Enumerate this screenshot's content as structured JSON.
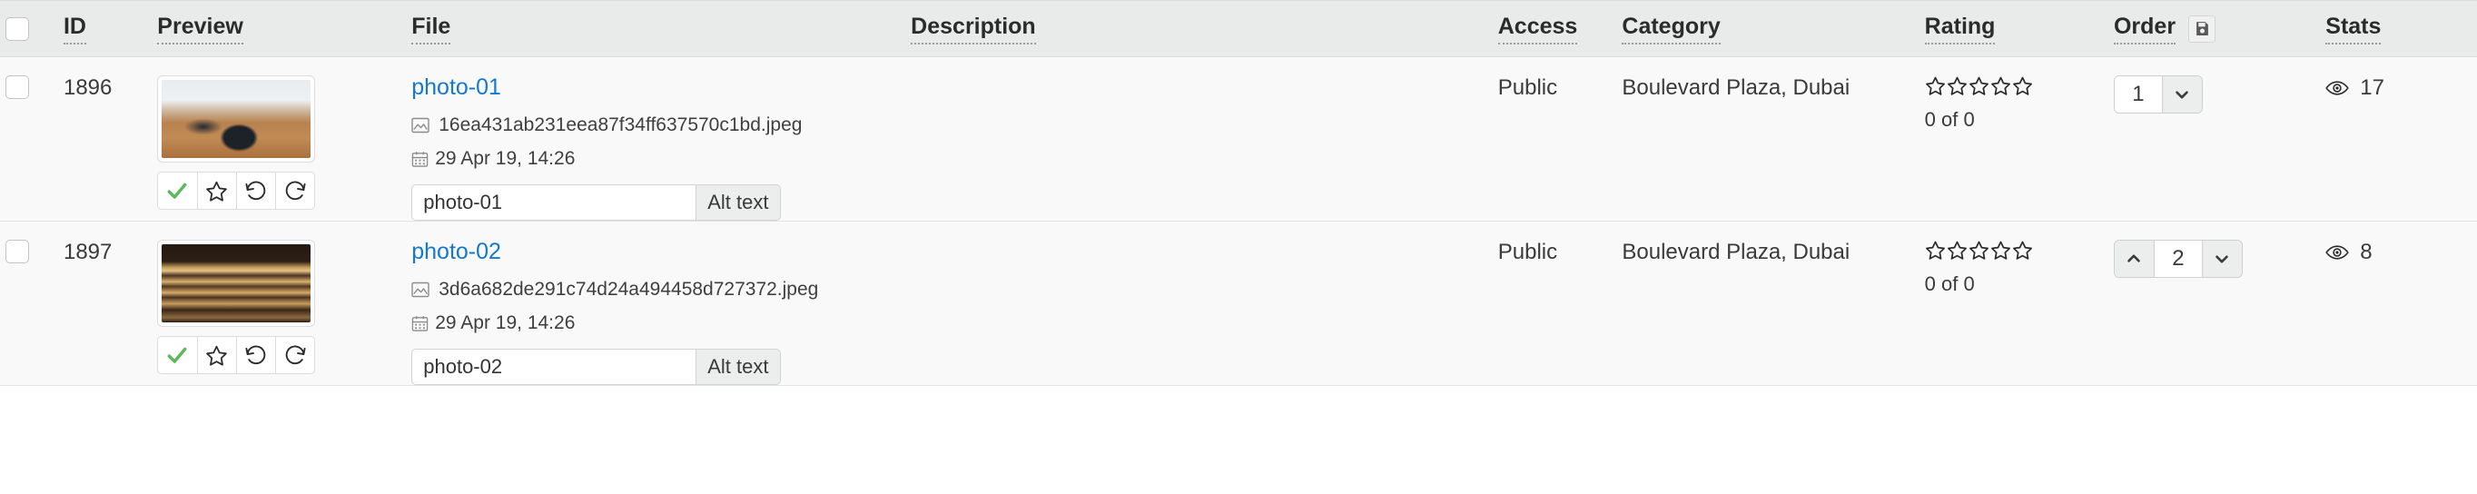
{
  "table": {
    "columns": [
      {
        "key": "select",
        "label": "",
        "name": "select-all-checkbox",
        "sortable": false
      },
      {
        "key": "id",
        "label": "ID",
        "name": "column-id",
        "sortable": true
      },
      {
        "key": "preview",
        "label": "Preview",
        "name": "column-preview",
        "sortable": true
      },
      {
        "key": "file",
        "label": "File",
        "name": "column-file",
        "sortable": true
      },
      {
        "key": "description",
        "label": "Description",
        "name": "column-description",
        "sortable": true
      },
      {
        "key": "access",
        "label": "Access",
        "name": "column-access",
        "sortable": true
      },
      {
        "key": "category",
        "label": "Category",
        "name": "column-category",
        "sortable": true
      },
      {
        "key": "rating",
        "label": "Rating",
        "name": "column-rating",
        "sortable": true
      },
      {
        "key": "order",
        "label": "Order",
        "name": "column-order",
        "sortable": true
      },
      {
        "key": "stats",
        "label": "Stats",
        "name": "column-stats",
        "sortable": true
      }
    ],
    "order_save_icon": "floppy-disk-save-icon",
    "header_bg": "#e9eaea",
    "row_bg": "#f9f9f9",
    "link_color": "#1578cf",
    "approved_color": "#5cb85c"
  },
  "rows": [
    {
      "id": "1896",
      "selected": false,
      "preview": {
        "thumb_class": "thumb-a",
        "actions": [
          {
            "name": "approve-button",
            "icon": "check-icon"
          },
          {
            "name": "feature-button",
            "icon": "star-icon"
          },
          {
            "name": "rotate-left-button",
            "icon": "rotate-left-icon"
          },
          {
            "name": "rotate-right-button",
            "icon": "rotate-right-icon"
          }
        ]
      },
      "file": {
        "title": "photo-01",
        "filename": "16ea431ab231eea87f34ff637570c1bd.jpeg",
        "date": "29 Apr 19, 14:26",
        "alt_text_value": "photo-01",
        "alt_text_placeholder": "Alt text",
        "alt_text_addon": "Alt text"
      },
      "description": "",
      "access": "Public",
      "category": "Boulevard Plaza, Dubai",
      "rating": {
        "stars_filled": 0,
        "stars_total": 5,
        "count_label": "0 of 0"
      },
      "order": {
        "value": "1",
        "has_up": false,
        "has_down": true
      },
      "stats": {
        "views": "17",
        "icon": "eye-icon"
      }
    },
    {
      "id": "1897",
      "selected": false,
      "preview": {
        "thumb_class": "thumb-b",
        "actions": [
          {
            "name": "approve-button",
            "icon": "check-icon"
          },
          {
            "name": "feature-button",
            "icon": "star-icon"
          },
          {
            "name": "rotate-left-button",
            "icon": "rotate-left-icon"
          },
          {
            "name": "rotate-right-button",
            "icon": "rotate-right-icon"
          }
        ]
      },
      "file": {
        "title": "photo-02",
        "filename": "3d6a682de291c74d24a494458d727372.jpeg",
        "date": "29 Apr 19, 14:26",
        "alt_text_value": "photo-02",
        "alt_text_placeholder": "Alt text",
        "alt_text_addon": "Alt text"
      },
      "description": "",
      "access": "Public",
      "category": "Boulevard Plaza, Dubai",
      "rating": {
        "stars_filled": 0,
        "stars_total": 5,
        "count_label": "0 of 0"
      },
      "order": {
        "value": "2",
        "has_up": true,
        "has_down": true
      },
      "stats": {
        "views": "8",
        "icon": "eye-icon"
      }
    }
  ]
}
